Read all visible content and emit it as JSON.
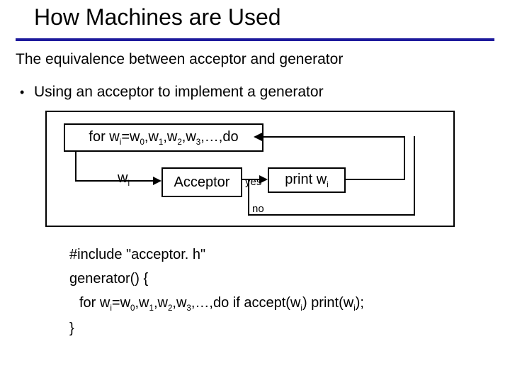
{
  "title": "How Machines are Used",
  "subtitle": "The equivalence between acceptor and generator",
  "bullet": "Using an acceptor to implement a generator",
  "diagram": {
    "for_prefix": "for w",
    "for_mid1": "=w",
    "for_mid2": ",w",
    "for_mid3": ",w",
    "for_mid4": ",w",
    "for_suffix": ",…,do",
    "i": "i",
    "d0": "0",
    "d1": "1",
    "d2": "2",
    "d3": "3",
    "wi_w": "w",
    "acceptor": "Acceptor",
    "yes": "yes",
    "no": "no",
    "print_prefix": "print w"
  },
  "code": {
    "l1": "#include \"acceptor. h\"",
    "l2": "generator() {",
    "l3_a": "for w",
    "l3_b": "=w",
    "l3_c": ",w",
    "l3_d": ",w",
    "l3_e": ",w",
    "l3_f": ",…,do if accept(w",
    "l3_g": ") print(w",
    "l3_h": ");",
    "l4": "}"
  }
}
